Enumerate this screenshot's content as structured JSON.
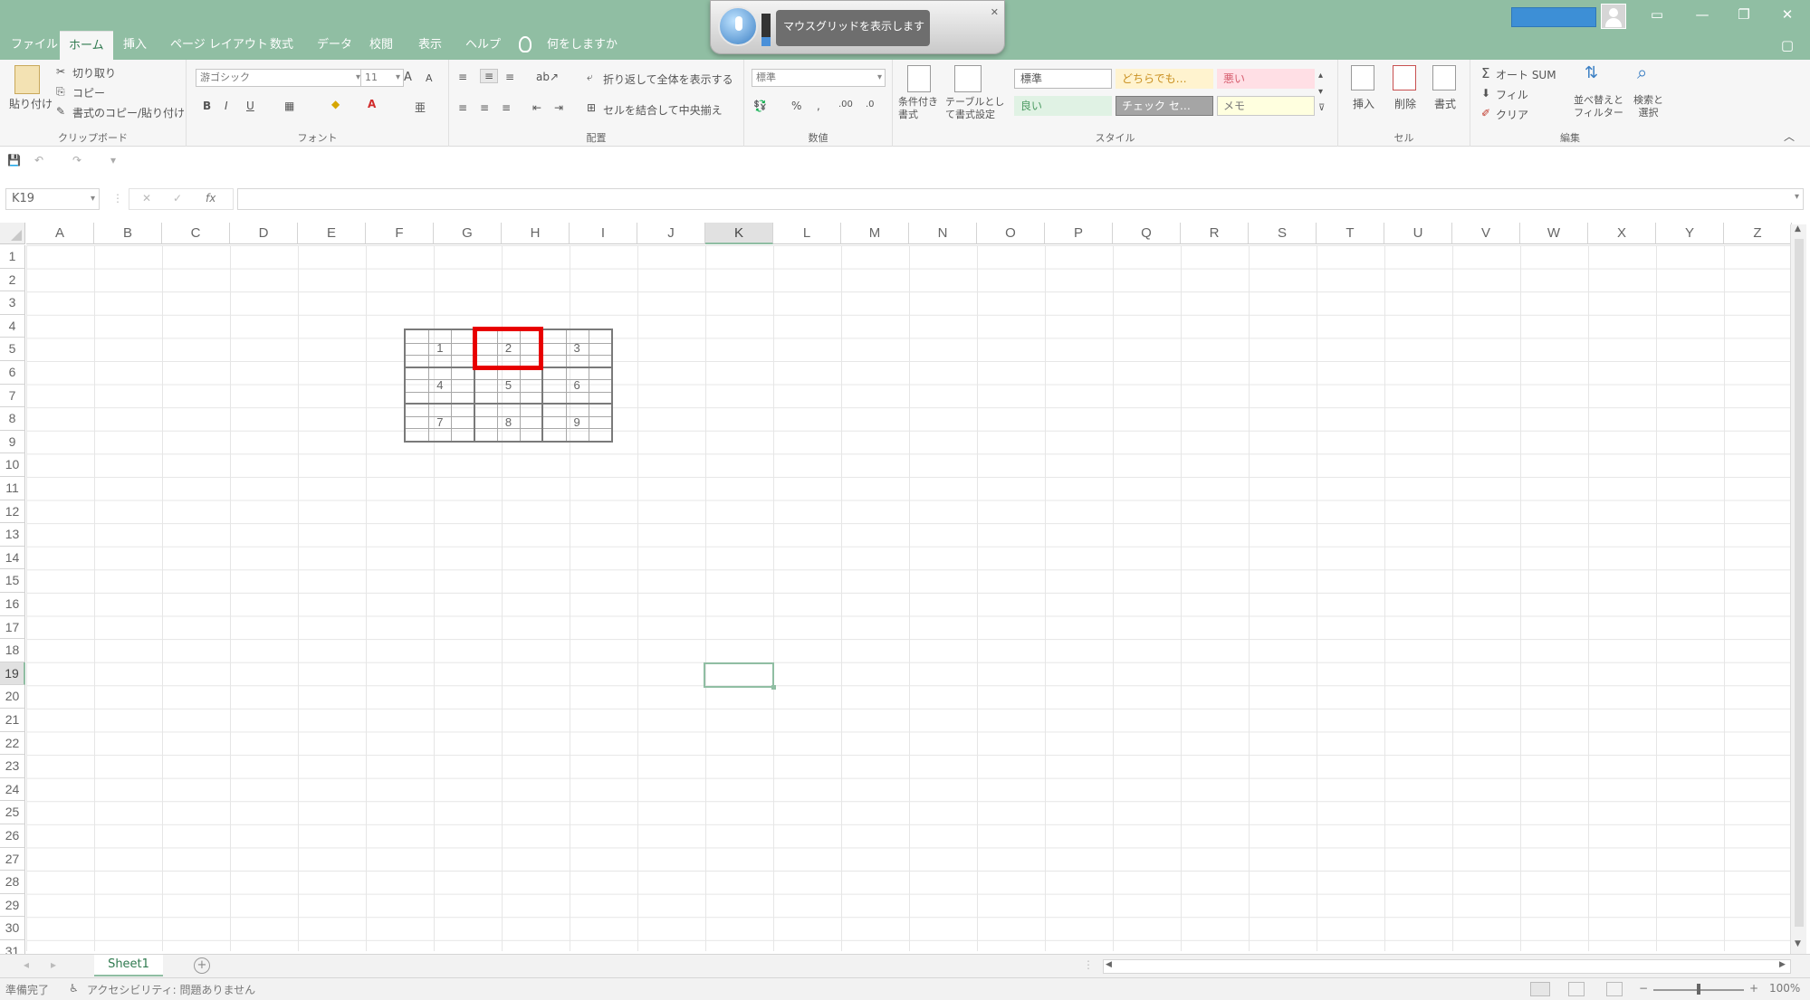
{
  "ribbon_tabs": [
    "ファイル",
    "ホーム",
    "挿入",
    "ページ レイアウト",
    "数式",
    "データ",
    "校閲",
    "表示",
    "ヘルプ"
  ],
  "tell_me": "何をしますか",
  "dictation": {
    "status": "マウスグリッドを表示します",
    "close_label": "✕"
  },
  "clipboard": {
    "paste": "貼り付け",
    "cut": "切り取り",
    "copy": "コピー",
    "format_painter": "書式のコピー/貼り付け",
    "label": "クリップボード"
  },
  "font": {
    "name": "游ゴシック",
    "size": "11",
    "grow": "A",
    "shrink": "A",
    "bold": "B",
    "italic": "I",
    "underline": "U",
    "label": "フォント"
  },
  "alignment": {
    "wrap_text": "折り返して全体を表示する",
    "merge_center": "セルを結合して中央揃え",
    "label": "配置"
  },
  "number": {
    "format": "標準",
    "percent": "%",
    "comma": ",",
    "label": "数値"
  },
  "styles": {
    "conditional": "条件付き書式",
    "table": "テーブルとして書式設定",
    "cells": [
      {
        "label": "標準",
        "bg": "#ffffff",
        "color": "#555555",
        "border": "#b7b7b7"
      },
      {
        "label": "どちらでも…",
        "bg": "#fff3cf",
        "color": "#c98f1f",
        "border": "#fff3cf"
      },
      {
        "label": "悪い",
        "bg": "#ffdfe5",
        "color": "#d65c6e",
        "border": "#ffdfe5"
      },
      {
        "label": "良い",
        "bg": "#e0f2e4",
        "color": "#4e9c64",
        "border": "#e0f2e4"
      },
      {
        "label": "チェック セ…",
        "bg": "#a5a5a5",
        "color": "#ffffff",
        "border": "#7c7c7c"
      },
      {
        "label": "メモ",
        "bg": "#ffffdf",
        "color": "#777777",
        "border": "#c9c9c9"
      }
    ],
    "label": "スタイル"
  },
  "cells_group": {
    "insert": "挿入",
    "delete": "削除",
    "format": "書式",
    "label": "セル"
  },
  "editing": {
    "autosum": "オート SUM",
    "fill": "フィル",
    "clear": "クリア",
    "sort_filter": "並べ替えと\nフィルター",
    "find_select": "検索と\n選択",
    "label": "編集"
  },
  "name_box": "K19",
  "fx_label": "fx",
  "formula_value": "",
  "columns": [
    "A",
    "B",
    "C",
    "D",
    "E",
    "F",
    "G",
    "H",
    "I",
    "J",
    "K",
    "L",
    "M",
    "N",
    "O",
    "P",
    "Q",
    "R",
    "S",
    "T",
    "U",
    "V",
    "W",
    "X",
    "Y",
    "Z"
  ],
  "selected_column": "K",
  "rows": [
    "1",
    "2",
    "3",
    "4",
    "5",
    "6",
    "7",
    "8",
    "9",
    "10",
    "11",
    "12",
    "13",
    "14",
    "15",
    "16",
    "17",
    "18",
    "19",
    "20",
    "21",
    "22",
    "23",
    "24",
    "25",
    "26",
    "27",
    "28",
    "29",
    "30",
    "31"
  ],
  "selected_row": "19",
  "mouse_grid": {
    "numbers": [
      "1",
      "2",
      "3",
      "4",
      "5",
      "6",
      "7",
      "8",
      "9"
    ],
    "highlighted": "2"
  },
  "sheet_tab": "Sheet1",
  "add_sheet": "+",
  "status": {
    "ready": "準備完了",
    "accessibility": "アクセシビリティ: 問題ありません",
    "zoom": "100%",
    "zoom_minus": "−",
    "zoom_plus": "+"
  },
  "colors": {
    "accent": "#90bea3",
    "highlight": "#e80000"
  }
}
